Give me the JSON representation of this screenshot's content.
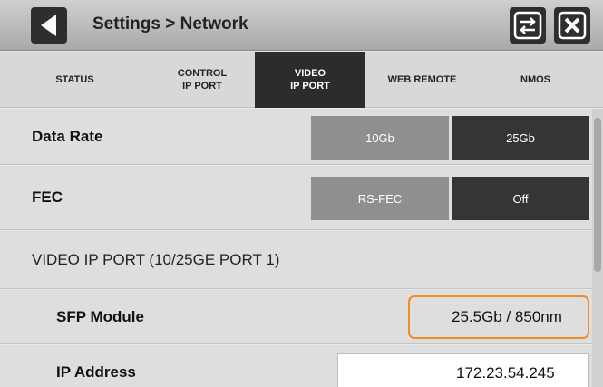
{
  "header": {
    "title": "Settings > Network"
  },
  "tabs": [
    {
      "label": "STATUS",
      "active": false
    },
    {
      "label": "CONTROL\nIP PORT",
      "active": false
    },
    {
      "label": "VIDEO\nIP PORT",
      "active": true
    },
    {
      "label": "WEB REMOTE",
      "active": false
    },
    {
      "label": "NMOS",
      "active": false
    }
  ],
  "rows": {
    "data_rate": {
      "label": "Data Rate",
      "options": [
        "10Gb",
        "25Gb"
      ],
      "selected": "25Gb"
    },
    "fec": {
      "label": "FEC",
      "options": [
        "RS-FEC",
        "Off"
      ],
      "selected": "Off"
    },
    "section": {
      "label": "VIDEO IP PORT (10/25GE PORT 1)"
    },
    "sfp": {
      "label": "SFP Module",
      "value": "25.5Gb / 850nm"
    },
    "ip": {
      "label": "IP Address",
      "value": "172.23.54.245"
    }
  },
  "colors": {
    "highlight": "#f28c28",
    "active_tab": "#2c2c2c",
    "selected_segment": "#353535",
    "unselected_segment": "#8f8f8f"
  }
}
